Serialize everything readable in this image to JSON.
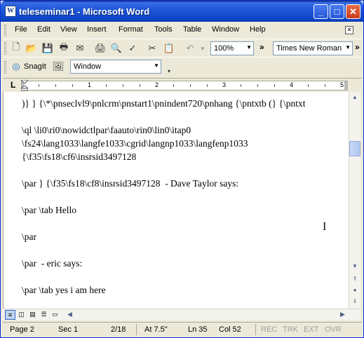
{
  "window": {
    "title": "teleseminar1 - Microsoft Word",
    "app_icon_letter": "W",
    "min_glyph": "_",
    "max_glyph": "□",
    "close_glyph": "✕"
  },
  "menu": {
    "items": [
      {
        "label": "File"
      },
      {
        "label": "Edit"
      },
      {
        "label": "View"
      },
      {
        "label": "Insert"
      },
      {
        "label": "Format"
      },
      {
        "label": "Tools"
      },
      {
        "label": "Table"
      },
      {
        "label": "Window"
      },
      {
        "label": "Help"
      }
    ]
  },
  "toolbar": {
    "zoom": "100%",
    "font": "Times New Roman",
    "snagit_label": "SnagIt",
    "window_combo": "Window",
    "more_glyph": "»"
  },
  "ruler": {
    "numbers": [
      "1",
      "2",
      "3",
      "4",
      "5"
    ],
    "tab_selector": "L"
  },
  "document": {
    "lines": [
      ")} } {\\*\\pnseclvl9\\pnlcrm\\pnstart1\\pnindent720\\pnhang {\\pntxtb (} {\\pntxt",
      "",
      "\\ql \\li0\\ri0\\nowidctlpar\\faauto\\rin0\\lin0\\itap0",
      "\\fs24\\lang1033\\langfe1033\\cgrid\\langnp1033\\langfenp1033",
      "{\\f35\\fs18\\cf6\\insrsid3497128",
      "",
      "\\par } {\\f35\\fs18\\cf8\\insrsid3497128  - Dave Taylor says:",
      "",
      "\\par \\tab Hello",
      "",
      "\\par",
      "",
      "\\par  - eric says:",
      "",
      "\\par \\tab yes i am here"
    ],
    "cursor_glyph": "I"
  },
  "statusbar": {
    "page": "Page 2",
    "sec": "Sec 1",
    "pages": "2/18",
    "at": "At 7.5\"",
    "ln": "Ln 35",
    "col": "Col 52",
    "rec": "REC",
    "trk": "TRK",
    "ext": "EXT",
    "ovr": "OVR"
  }
}
